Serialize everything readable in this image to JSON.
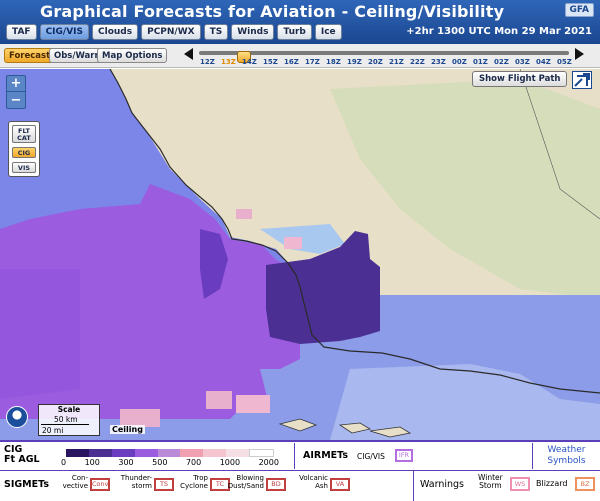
{
  "header": {
    "title": "Graphical Forecasts for Aviation - Ceiling/Visibility",
    "badge": "GFA",
    "product_tabs": [
      "TAF",
      "CIG/VIS",
      "Clouds",
      "PCPN/WX",
      "TS",
      "Winds",
      "Turb",
      "Ice"
    ],
    "active_tab": "CIG/VIS",
    "time_label": "+2hr 1300 UTC Mon 29 Mar 2021"
  },
  "toolbar": {
    "forecast": "Forecast",
    "obs_warn": "Obs/Warn",
    "map_options": "Map Options",
    "timeline_hours": [
      "12Z",
      "13Z",
      "14Z",
      "15Z",
      "16Z",
      "17Z",
      "18Z",
      "19Z",
      "20Z",
      "21Z",
      "22Z",
      "23Z",
      "00Z",
      "01Z",
      "02Z",
      "03Z",
      "04Z",
      "05Z"
    ],
    "current_hour": "13Z"
  },
  "map": {
    "zoom_in": "+",
    "zoom_out": "−",
    "layer_flt_cat": "FLT CAT",
    "layer_cig": "CIG",
    "layer_vis": "VIS",
    "show_flight_path": "Show Flight Path",
    "scale_title": "Scale",
    "scale_km": "50 km",
    "scale_mi": "20 mi",
    "layer_label": "Ceiling",
    "colors": {
      "land": "#e8dfc8",
      "ocean_blue": "#7b86e8",
      "ifr_purple": "#9c5ce0",
      "lifr_dark": "#4b2f92",
      "mvfr_pink": "#e8b0cc",
      "light_blue": "#a8c8f0",
      "green_tint": "#c8dcb0"
    }
  },
  "legend": {
    "cig_title_line1": "CIG",
    "cig_title_line2": "Ft AGL",
    "cig_colors": [
      "#2a1660",
      "#4b2f92",
      "#6a3cbf",
      "#9c5ce0",
      "#b98ad8",
      "#f0a0b0",
      "#f6c6d0",
      "#f4e0e4",
      "#ffffff"
    ],
    "cig_ticks": [
      "0",
      "100",
      "300",
      "500",
      "700",
      "1000",
      "2000"
    ],
    "airmets_label": "AIRMETs",
    "airmet_item": "CIG/VIS",
    "airmet_code": "IFR",
    "weather_symbols": "Weather Symbols",
    "sigmets_label": "SIGMETs",
    "sigmets": [
      {
        "text": "Con-\nvective",
        "code": "Conv",
        "color": "#c04040"
      },
      {
        "text": "Thunder-\nstorm",
        "code": "TS",
        "color": "#c04040"
      },
      {
        "text": "Trop\nCyclone",
        "code": "TC",
        "color": "#c04040"
      },
      {
        "text": "Blowing\nDust/Sand",
        "code": "BD",
        "color": "#c04040"
      },
      {
        "text": "Volcanic\nAsh",
        "code": "VA",
        "color": "#c04040"
      }
    ],
    "warnings_label": "Warnings",
    "warn_winter": "Winter\nStorm",
    "warn_winter_code": "WS",
    "warn_blizzard": "Blizzard",
    "warn_blizzard_code": "BZ"
  }
}
